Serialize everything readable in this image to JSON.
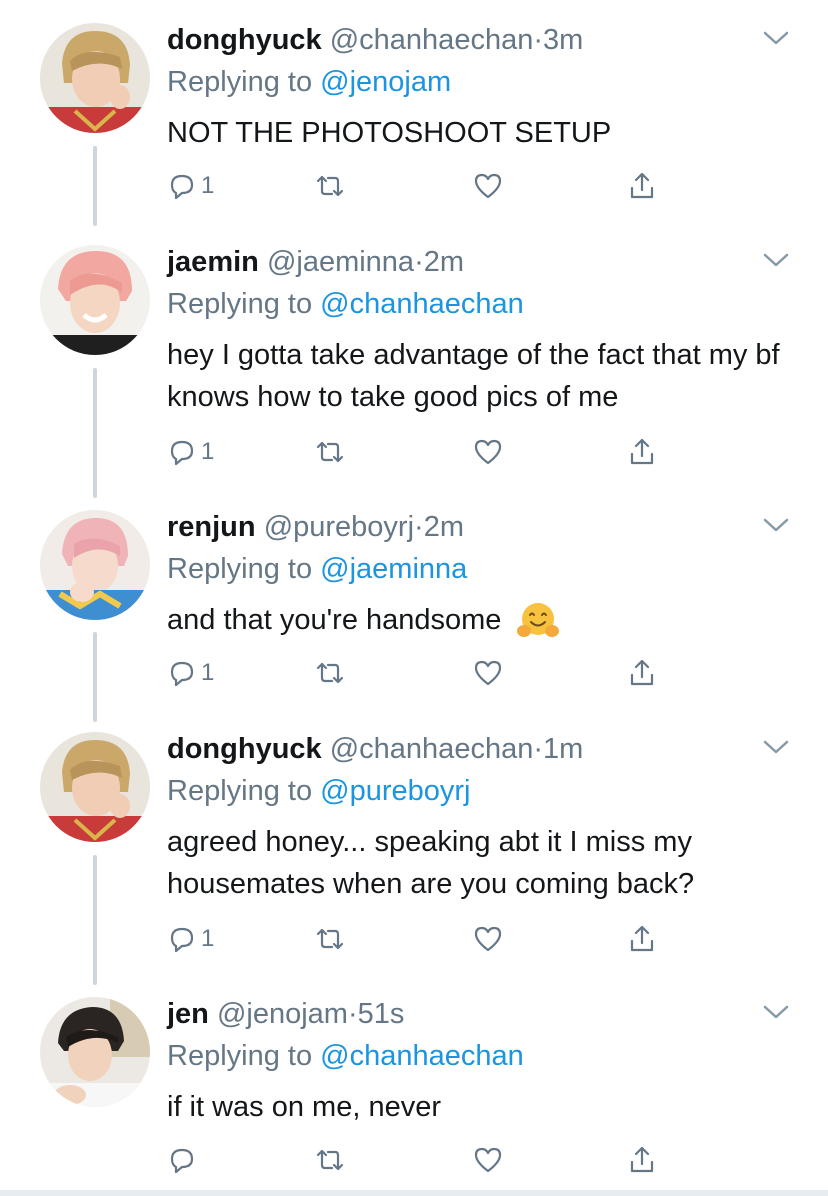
{
  "colors": {
    "text": "#14171a",
    "secondary": "#657786",
    "link": "#1b95e0",
    "line": "#ccd6dd"
  },
  "tweets": [
    {
      "name": "donghyuck",
      "handle": "@chanhaechan",
      "dot": "·",
      "time": "3m",
      "replying_prefix": "Replying to ",
      "replying_to": "@jenojam",
      "text": "NOT THE PHOTOSHOOT SETUP",
      "reply_count": "1",
      "avatar_icon": "avatar-donghyuck"
    },
    {
      "name": "jaemin",
      "handle": "@jaeminna",
      "dot": "·",
      "time": "2m",
      "replying_prefix": "Replying to ",
      "replying_to": "@chanhaechan",
      "text": "hey I gotta take advantage of the fact that my bf knows how to take good pics of me",
      "reply_count": "1",
      "avatar_icon": "avatar-jaemin"
    },
    {
      "name": "renjun",
      "handle": "@pureboyrj",
      "dot": "·",
      "time": "2m",
      "replying_prefix": "Replying to ",
      "replying_to": "@jaeminna",
      "text": "and that you're handsome",
      "emoji": "hugging-face-emoji",
      "reply_count": "1",
      "avatar_icon": "avatar-renjun"
    },
    {
      "name": "donghyuck",
      "handle": "@chanhaechan",
      "dot": "·",
      "time": "1m",
      "replying_prefix": "Replying to ",
      "replying_to": "@pureboyrj",
      "text": "agreed honey... speaking abt it I miss my housemates when are you coming back?",
      "reply_count": "1",
      "avatar_icon": "avatar-donghyuck"
    },
    {
      "name": "jen",
      "handle": "@jenojam",
      "dot": "·",
      "time": "51s",
      "replying_prefix": "Replying to ",
      "replying_to": "@chanhaechan",
      "text": "if it was on me, never",
      "reply_count": "",
      "avatar_icon": "avatar-jen"
    }
  ]
}
